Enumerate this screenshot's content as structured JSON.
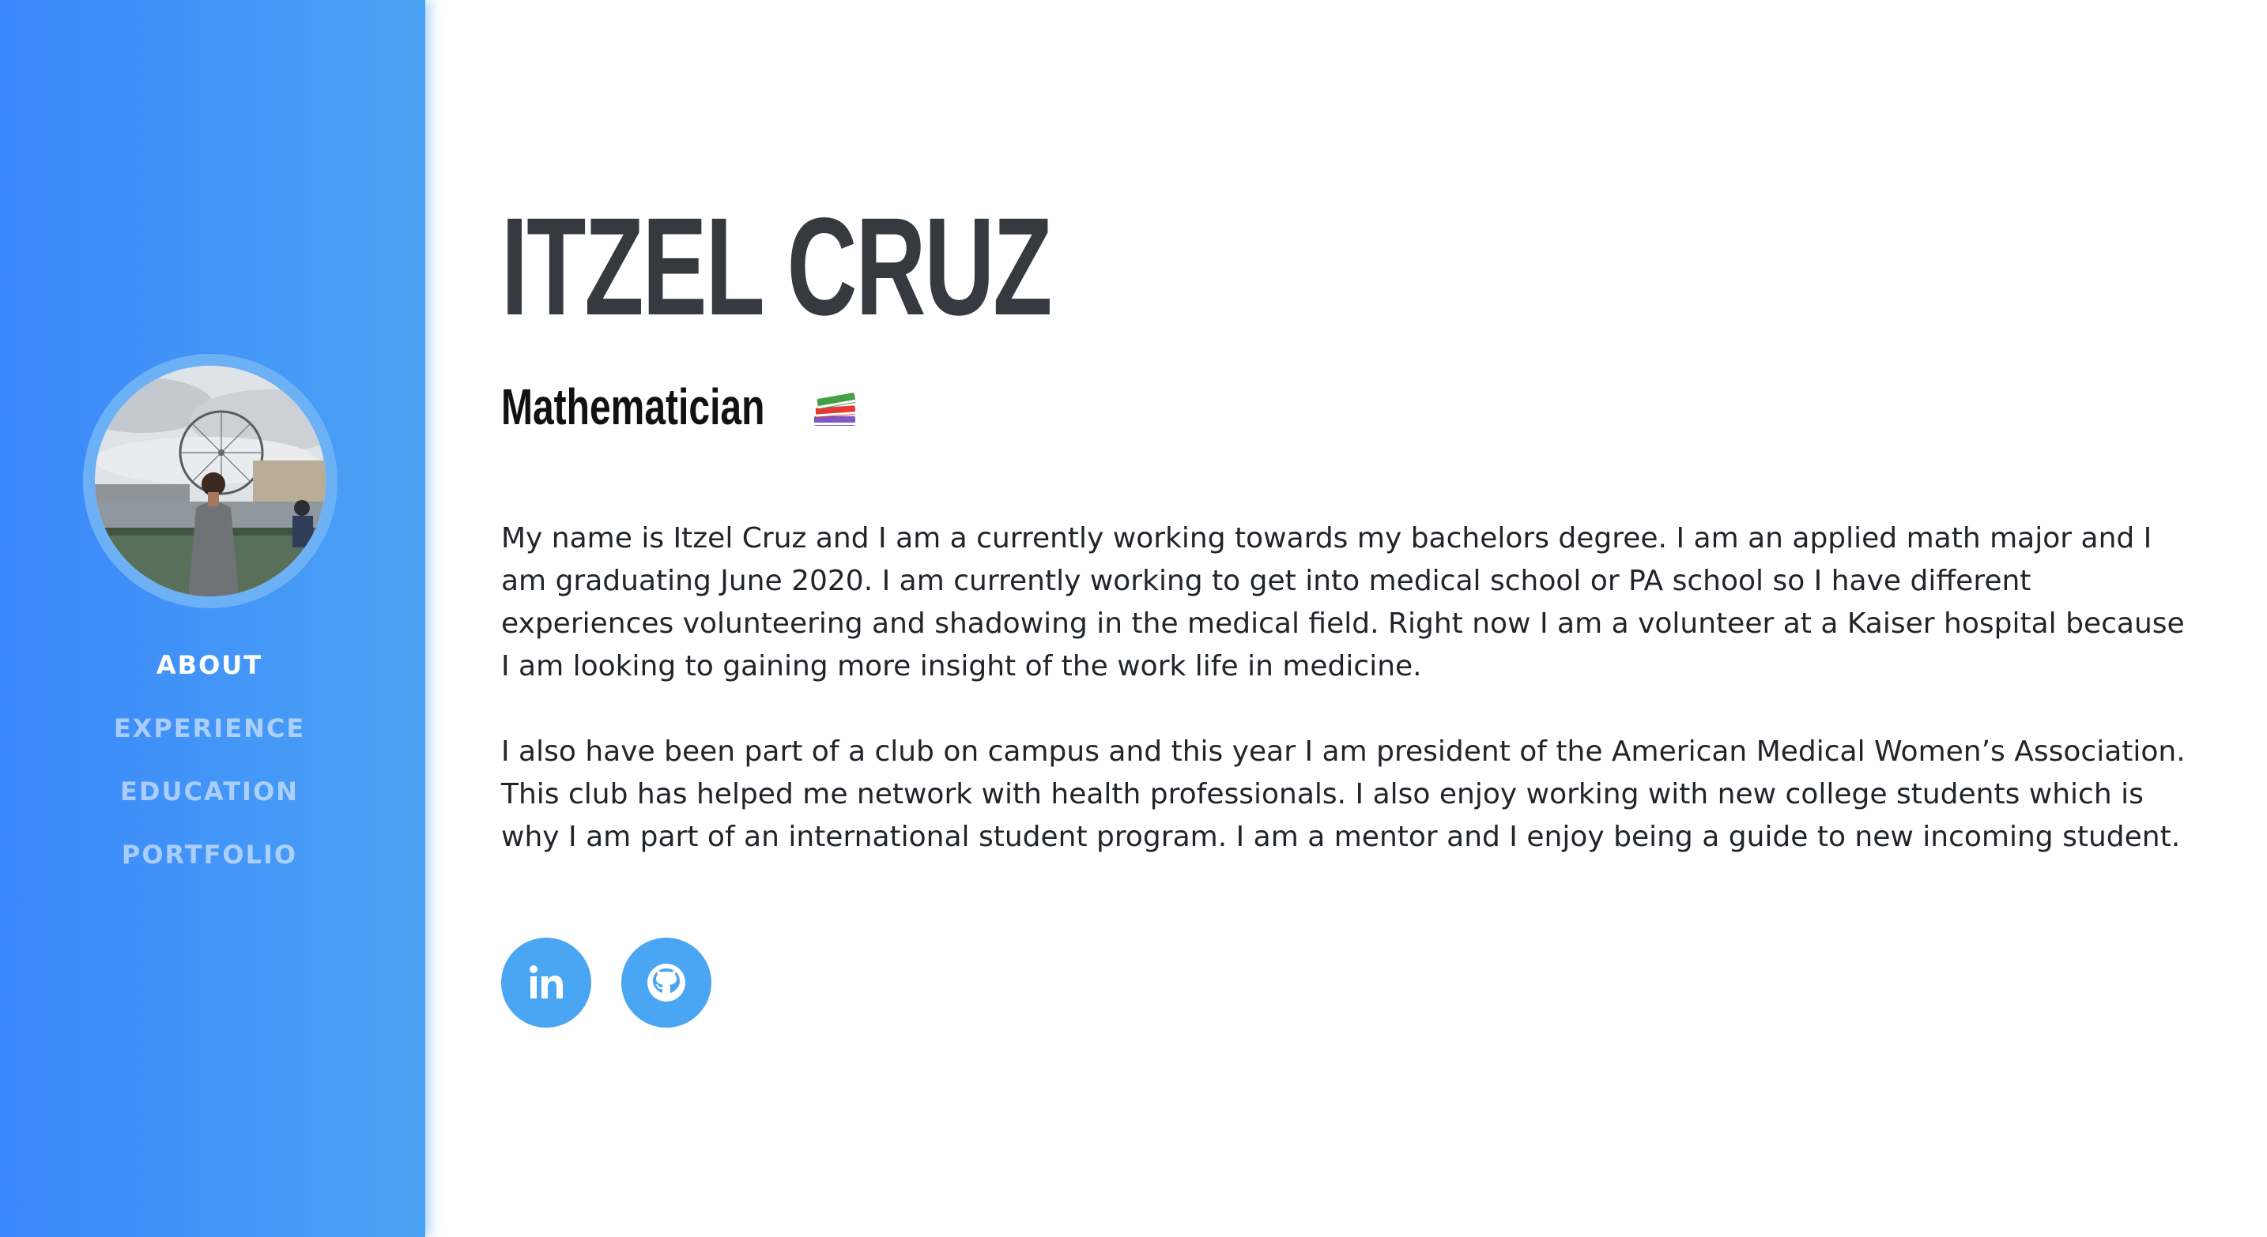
{
  "sidebar": {
    "avatar_alt": "Profile photo",
    "nav": [
      {
        "label": "ABOUT",
        "active": true
      },
      {
        "label": "EXPERIENCE",
        "active": false
      },
      {
        "label": "EDUCATION",
        "active": false
      },
      {
        "label": "PORTFOLIO",
        "active": false
      }
    ]
  },
  "main": {
    "name": "ITZEL CRUZ",
    "subtitle": "Mathematician",
    "subtitle_icon": "books-icon",
    "paragraphs": [
      "My name is Itzel Cruz and I am a currently working towards my bachelors degree. I am an applied math major and I am graduating June 2020. I am currently working to get into medical school or PA school so I have different experiences volunteering and shadowing in the medical field. Right now I am a volunteer at a Kaiser hospital because I am looking to gaining more insight of the work life in medicine.",
      "I also have been part of a club on campus and this year I am president of the American Medical Women’s Association. This club has helped me network with health professionals. I also enjoy working with new college students which is why I am part of an international student program. I am a mentor and I enjoy being a guide to new incoming student."
    ],
    "socials": [
      {
        "name": "linkedin",
        "icon": "linkedin-icon"
      },
      {
        "name": "github",
        "icon": "github-icon"
      }
    ]
  },
  "colors": {
    "sidebar_start": "#3a86fb",
    "sidebar_end": "#4ba3f4",
    "social_bg": "#4aa6f3",
    "heading": "#343a40",
    "text": "#212529"
  }
}
